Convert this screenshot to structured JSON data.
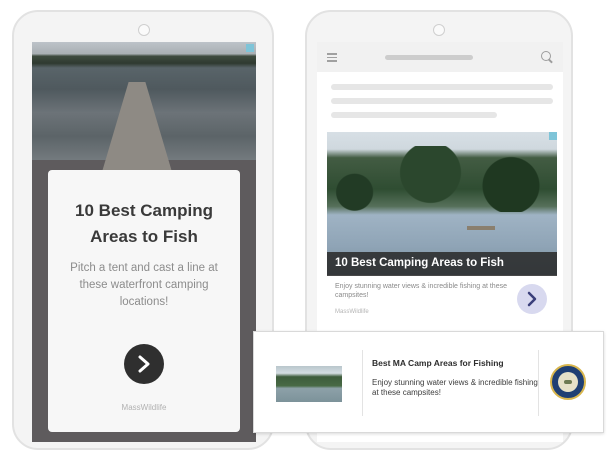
{
  "left_ad": {
    "title": "10 Best Camping Areas to Fish",
    "description": "Pitch a tent and cast a line at these waterfront camping locations!",
    "brand": "MassWildlife"
  },
  "right_ad": {
    "caption": "10 Best Camping Areas to Fish",
    "description": "Enjoy stunning water views & incredible fishing at these campsites!",
    "brand": "MassWildlife"
  },
  "banner": {
    "title": "Best MA Camp Areas for Fishing",
    "description": "Enjoy stunning water views & incredible fishing at these campsites!"
  },
  "icons": {
    "next": "chevron-right-icon",
    "menu": "hamburger-menu-icon",
    "search": "search-icon",
    "ad_choice": "ad-choices-icon"
  },
  "colors": {
    "dark_button": "#2f2f2f",
    "light_button": "#d8d9ef",
    "caption_bar": "#2e2e2e",
    "seal_blue": "#1f3f73",
    "seal_gold": "#d8b64e"
  }
}
